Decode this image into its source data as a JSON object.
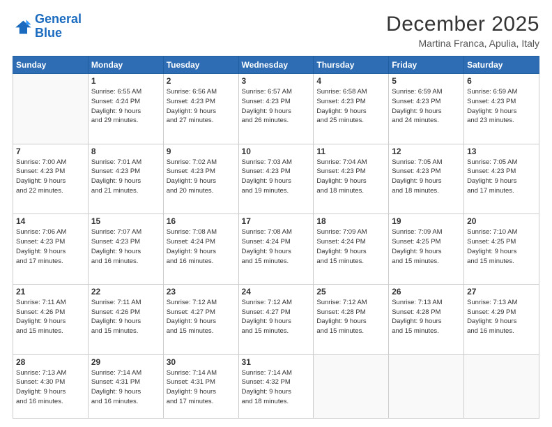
{
  "header": {
    "logo_line1": "General",
    "logo_line2": "Blue",
    "month": "December 2025",
    "location": "Martina Franca, Apulia, Italy"
  },
  "days_of_week": [
    "Sunday",
    "Monday",
    "Tuesday",
    "Wednesday",
    "Thursday",
    "Friday",
    "Saturday"
  ],
  "weeks": [
    [
      {
        "day": "",
        "info": ""
      },
      {
        "day": "1",
        "info": "Sunrise: 6:55 AM\nSunset: 4:24 PM\nDaylight: 9 hours\nand 29 minutes."
      },
      {
        "day": "2",
        "info": "Sunrise: 6:56 AM\nSunset: 4:23 PM\nDaylight: 9 hours\nand 27 minutes."
      },
      {
        "day": "3",
        "info": "Sunrise: 6:57 AM\nSunset: 4:23 PM\nDaylight: 9 hours\nand 26 minutes."
      },
      {
        "day": "4",
        "info": "Sunrise: 6:58 AM\nSunset: 4:23 PM\nDaylight: 9 hours\nand 25 minutes."
      },
      {
        "day": "5",
        "info": "Sunrise: 6:59 AM\nSunset: 4:23 PM\nDaylight: 9 hours\nand 24 minutes."
      },
      {
        "day": "6",
        "info": "Sunrise: 6:59 AM\nSunset: 4:23 PM\nDaylight: 9 hours\nand 23 minutes."
      }
    ],
    [
      {
        "day": "7",
        "info": "Sunrise: 7:00 AM\nSunset: 4:23 PM\nDaylight: 9 hours\nand 22 minutes."
      },
      {
        "day": "8",
        "info": "Sunrise: 7:01 AM\nSunset: 4:23 PM\nDaylight: 9 hours\nand 21 minutes."
      },
      {
        "day": "9",
        "info": "Sunrise: 7:02 AM\nSunset: 4:23 PM\nDaylight: 9 hours\nand 20 minutes."
      },
      {
        "day": "10",
        "info": "Sunrise: 7:03 AM\nSunset: 4:23 PM\nDaylight: 9 hours\nand 19 minutes."
      },
      {
        "day": "11",
        "info": "Sunrise: 7:04 AM\nSunset: 4:23 PM\nDaylight: 9 hours\nand 18 minutes."
      },
      {
        "day": "12",
        "info": "Sunrise: 7:05 AM\nSunset: 4:23 PM\nDaylight: 9 hours\nand 18 minutes."
      },
      {
        "day": "13",
        "info": "Sunrise: 7:05 AM\nSunset: 4:23 PM\nDaylight: 9 hours\nand 17 minutes."
      }
    ],
    [
      {
        "day": "14",
        "info": "Sunrise: 7:06 AM\nSunset: 4:23 PM\nDaylight: 9 hours\nand 17 minutes."
      },
      {
        "day": "15",
        "info": "Sunrise: 7:07 AM\nSunset: 4:23 PM\nDaylight: 9 hours\nand 16 minutes."
      },
      {
        "day": "16",
        "info": "Sunrise: 7:08 AM\nSunset: 4:24 PM\nDaylight: 9 hours\nand 16 minutes."
      },
      {
        "day": "17",
        "info": "Sunrise: 7:08 AM\nSunset: 4:24 PM\nDaylight: 9 hours\nand 15 minutes."
      },
      {
        "day": "18",
        "info": "Sunrise: 7:09 AM\nSunset: 4:24 PM\nDaylight: 9 hours\nand 15 minutes."
      },
      {
        "day": "19",
        "info": "Sunrise: 7:09 AM\nSunset: 4:25 PM\nDaylight: 9 hours\nand 15 minutes."
      },
      {
        "day": "20",
        "info": "Sunrise: 7:10 AM\nSunset: 4:25 PM\nDaylight: 9 hours\nand 15 minutes."
      }
    ],
    [
      {
        "day": "21",
        "info": "Sunrise: 7:11 AM\nSunset: 4:26 PM\nDaylight: 9 hours\nand 15 minutes."
      },
      {
        "day": "22",
        "info": "Sunrise: 7:11 AM\nSunset: 4:26 PM\nDaylight: 9 hours\nand 15 minutes."
      },
      {
        "day": "23",
        "info": "Sunrise: 7:12 AM\nSunset: 4:27 PM\nDaylight: 9 hours\nand 15 minutes."
      },
      {
        "day": "24",
        "info": "Sunrise: 7:12 AM\nSunset: 4:27 PM\nDaylight: 9 hours\nand 15 minutes."
      },
      {
        "day": "25",
        "info": "Sunrise: 7:12 AM\nSunset: 4:28 PM\nDaylight: 9 hours\nand 15 minutes."
      },
      {
        "day": "26",
        "info": "Sunrise: 7:13 AM\nSunset: 4:28 PM\nDaylight: 9 hours\nand 15 minutes."
      },
      {
        "day": "27",
        "info": "Sunrise: 7:13 AM\nSunset: 4:29 PM\nDaylight: 9 hours\nand 16 minutes."
      }
    ],
    [
      {
        "day": "28",
        "info": "Sunrise: 7:13 AM\nSunset: 4:30 PM\nDaylight: 9 hours\nand 16 minutes."
      },
      {
        "day": "29",
        "info": "Sunrise: 7:14 AM\nSunset: 4:31 PM\nDaylight: 9 hours\nand 16 minutes."
      },
      {
        "day": "30",
        "info": "Sunrise: 7:14 AM\nSunset: 4:31 PM\nDaylight: 9 hours\nand 17 minutes."
      },
      {
        "day": "31",
        "info": "Sunrise: 7:14 AM\nSunset: 4:32 PM\nDaylight: 9 hours\nand 18 minutes."
      },
      {
        "day": "",
        "info": ""
      },
      {
        "day": "",
        "info": ""
      },
      {
        "day": "",
        "info": ""
      }
    ]
  ]
}
